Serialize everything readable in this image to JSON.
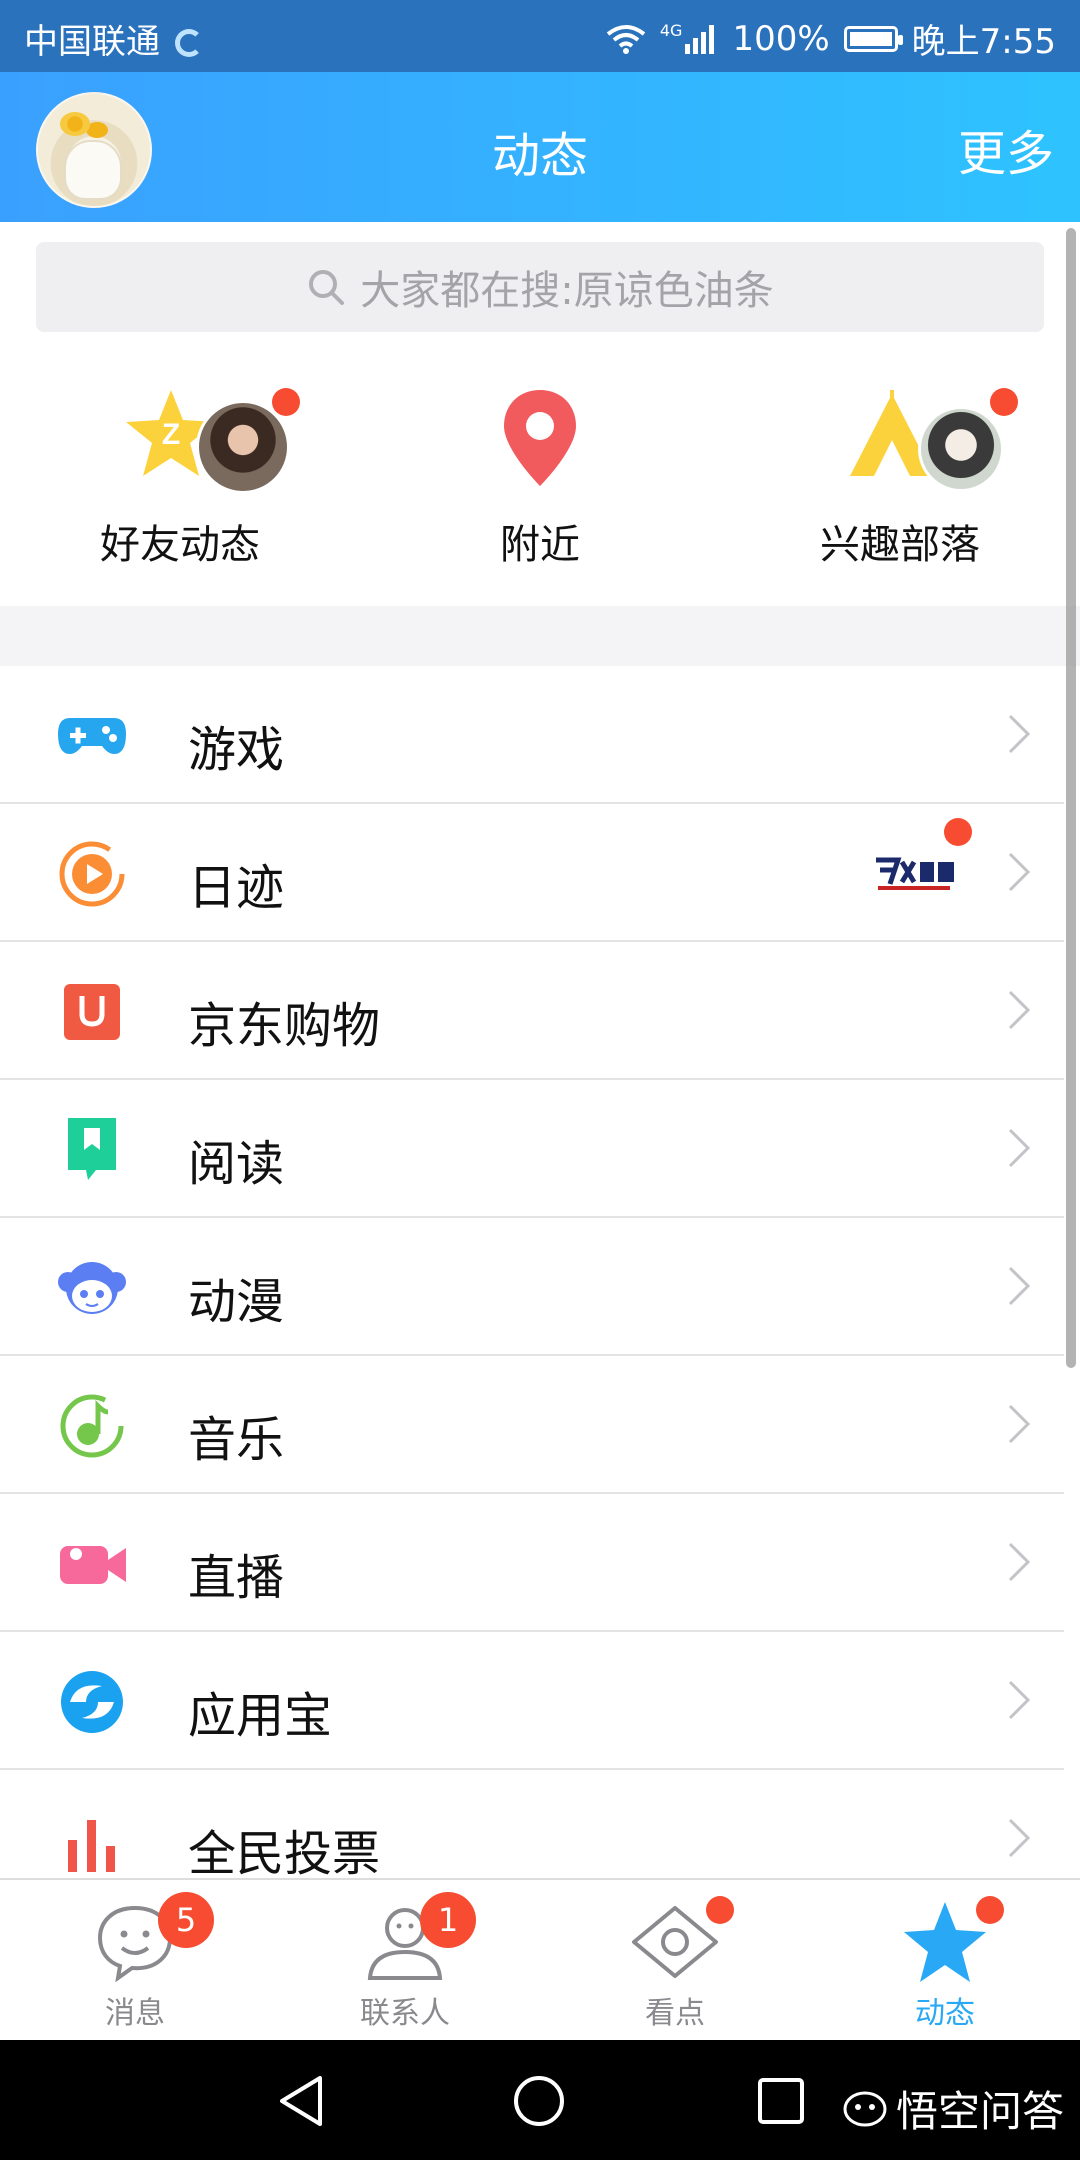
{
  "status_bar": {
    "carrier": "中国联通",
    "network": "4G",
    "battery": "100%",
    "time": "晚上7:55"
  },
  "header": {
    "title": "动态",
    "more": "更多"
  },
  "search": {
    "placeholder": "大家都在搜:原谅色油条"
  },
  "quick_entries": [
    {
      "label": "好友动态",
      "icon": "qzone-star-icon",
      "badge": true
    },
    {
      "label": "附近",
      "icon": "location-pin-icon",
      "badge": false
    },
    {
      "label": "兴趣部落",
      "icon": "tribe-tent-icon",
      "badge": true
    }
  ],
  "list": [
    {
      "label": "游戏",
      "icon": "gamepad-icon",
      "color": "#27a6f0"
    },
    {
      "label": "日迹",
      "icon": "play-circle-icon",
      "color": "#fb8d35",
      "extra_image": "dance-show-logo-icon",
      "badge": true
    },
    {
      "label": "京东购物",
      "icon": "jd-bag-icon",
      "color": "#f05a43"
    },
    {
      "label": "阅读",
      "icon": "book-bookmark-icon",
      "color": "#1fcf9a"
    },
    {
      "label": "动漫",
      "icon": "anime-face-icon",
      "color": "#5b7ef3"
    },
    {
      "label": "音乐",
      "icon": "music-note-icon",
      "color": "#74c74b"
    },
    {
      "label": "直播",
      "icon": "video-camera-icon",
      "color": "#f7699b"
    },
    {
      "label": "应用宝",
      "icon": "app-store-icon",
      "color": "#1aa2f0"
    },
    {
      "label": "全民投票",
      "icon": "bar-chart-icon",
      "color": "#f0554a"
    }
  ],
  "tabs": [
    {
      "label": "消息",
      "icon": "chat-face-icon",
      "badge": "5",
      "active": false
    },
    {
      "label": "联系人",
      "icon": "contact-person-icon",
      "badge": "1",
      "active": false
    },
    {
      "label": "看点",
      "icon": "eye-icon",
      "badge": "",
      "active": false
    },
    {
      "label": "动态",
      "icon": "star-icon",
      "badge": "",
      "active": true
    }
  ],
  "watermark": "悟空问答",
  "colors": {
    "header_start": "#3aa0ff",
    "header_end": "#2ec3ff",
    "badge": "#f74c31",
    "active_tab": "#29a8f5"
  }
}
